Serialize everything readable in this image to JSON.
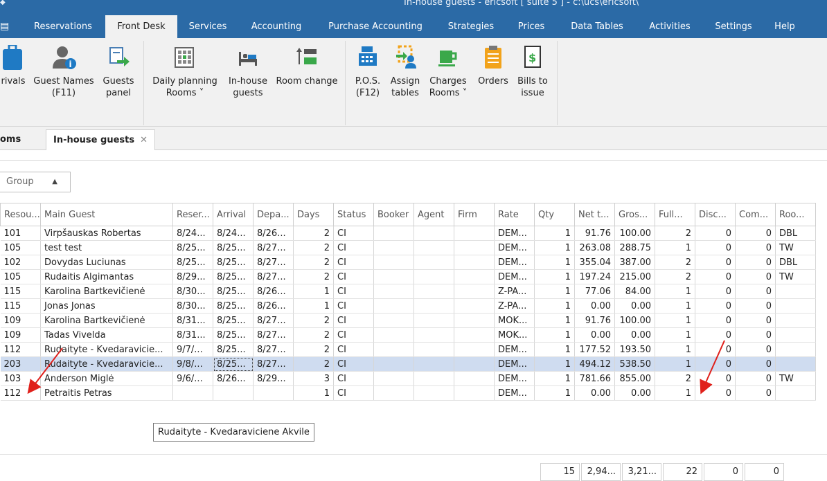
{
  "window": {
    "title": "In-house guests - ericsoft [ suite 5 ] - c:\\ucs\\ericsoft\\"
  },
  "menu": {
    "file_icon": "menu-file-icon",
    "tabs": [
      "Reservations",
      "Front Desk",
      "Services",
      "Accounting",
      "Purchase Accounting",
      "Strategies",
      "Prices",
      "Data Tables",
      "Activities",
      "Settings",
      "Help"
    ],
    "active": "Front Desk"
  },
  "ribbon": {
    "arrivals": "rivals",
    "guest_names": [
      "Guest Names",
      "(F11)"
    ],
    "guests_panel": [
      "Guests",
      "panel"
    ],
    "daily_planning": [
      "Daily planning",
      "Rooms ˅"
    ],
    "inhouse_guests": [
      "In-house",
      "guests"
    ],
    "room_change": [
      "Room change",
      ""
    ],
    "pos": [
      "P.O.S.",
      "(F12)"
    ],
    "assign_tables": [
      "Assign",
      "tables"
    ],
    "charges_rooms": [
      "Charges",
      "Rooms ˅"
    ],
    "orders": [
      "Orders",
      ""
    ],
    "bills_to_issue": [
      "Bills to",
      "issue"
    ]
  },
  "doc_tabs": {
    "rooms": "oms",
    "inhouse": "In-house guests",
    "close": "✕"
  },
  "group": {
    "label": "Group",
    "arrow": "▲"
  },
  "grid": {
    "columns": [
      "Resou...",
      "Main Guest",
      "Reser...",
      "Arrival",
      "Depa...",
      "Days",
      "Status",
      "Booker",
      "Agent",
      "Firm",
      "Rate",
      "Qty",
      "Net t...",
      "Gros...",
      "Full...",
      "Disc...",
      "Com...",
      "Roo..."
    ],
    "rows": [
      [
        "101",
        "Virpšauskas Robertas",
        "8/24...",
        "8/24...",
        "8/26...",
        "2",
        "CI",
        "",
        "",
        "",
        "DEM...",
        "1",
        "91.76",
        "100.00",
        "2",
        "0",
        "0",
        "DBL"
      ],
      [
        "105",
        "test test",
        "8/25...",
        "8/25...",
        "8/27...",
        "2",
        "CI",
        "",
        "",
        "",
        "DEM...",
        "1",
        "263.08",
        "288.75",
        "1",
        "0",
        "0",
        "TW"
      ],
      [
        "102",
        "Dovydas Luciunas",
        "8/25...",
        "8/25...",
        "8/27...",
        "2",
        "CI",
        "",
        "",
        "",
        "DEM...",
        "1",
        "355.04",
        "387.00",
        "2",
        "0",
        "0",
        "DBL"
      ],
      [
        "105",
        "Rudaitis Algimantas",
        "8/29...",
        "8/25...",
        "8/27...",
        "2",
        "CI",
        "",
        "",
        "",
        "DEM...",
        "1",
        "197.24",
        "215.00",
        "2",
        "0",
        "0",
        "TW"
      ],
      [
        "115",
        "Karolina Bartkevičienė",
        "8/30...",
        "8/25...",
        "8/26...",
        "1",
        "CI",
        "",
        "",
        "",
        "Z-PA...",
        "1",
        "77.06",
        "84.00",
        "1",
        "0",
        "0",
        ""
      ],
      [
        "115",
        "Jonas Jonas",
        "8/30...",
        "8/25...",
        "8/26...",
        "1",
        "CI",
        "",
        "",
        "",
        "Z-PA...",
        "1",
        "0.00",
        "0.00",
        "1",
        "0",
        "0",
        ""
      ],
      [
        "109",
        "Karolina Bartkevičienė",
        "8/31...",
        "8/25...",
        "8/27...",
        "2",
        "CI",
        "",
        "",
        "",
        "MOK...",
        "1",
        "91.76",
        "100.00",
        "1",
        "0",
        "0",
        ""
      ],
      [
        "109",
        "Tadas Vivelda",
        "8/31...",
        "8/25...",
        "8/27...",
        "2",
        "CI",
        "",
        "",
        "",
        "MOK...",
        "1",
        "0.00",
        "0.00",
        "1",
        "0",
        "0",
        ""
      ],
      [
        "112",
        "Rudaityte - Kvedaravicie...",
        "9/7/...",
        "8/25...",
        "8/27...",
        "2",
        "CI",
        "",
        "",
        "",
        "DEM...",
        "1",
        "177.52",
        "193.50",
        "1",
        "0",
        "0",
        ""
      ],
      [
        "203",
        "Rudaityte - Kvedaravicie...",
        "9/8/...",
        "8/25...",
        "8/27...",
        "2",
        "CI",
        "",
        "",
        "",
        "DEM...",
        "1",
        "494.12",
        "538.50",
        "1",
        "0",
        "0",
        ""
      ],
      [
        "103",
        "Anderson Miglė",
        "9/6/...",
        "8/26...",
        "8/29...",
        "3",
        "CI",
        "",
        "",
        "",
        "DEM...",
        "1",
        "781.66",
        "855.00",
        "2",
        "0",
        "0",
        "TW"
      ],
      [
        "112",
        "Petraitis Petras",
        "",
        "",
        "",
        "1",
        "CI",
        "",
        "",
        "",
        "DEM...",
        "1",
        "0.00",
        "0.00",
        "1",
        "0",
        "0",
        ""
      ]
    ],
    "selected_row": 9
  },
  "totals": {
    "qty": "15",
    "net": "2,94...",
    "gross": "3,21...",
    "full": "22",
    "disc": "0",
    "com": "0"
  },
  "tooltip": "Rudaityte - Kvedaraviciene Akvile",
  "colors": {
    "titlebar": "#2b6aa6",
    "selection": "#cfdcf0",
    "annotation": "#e0201b"
  }
}
